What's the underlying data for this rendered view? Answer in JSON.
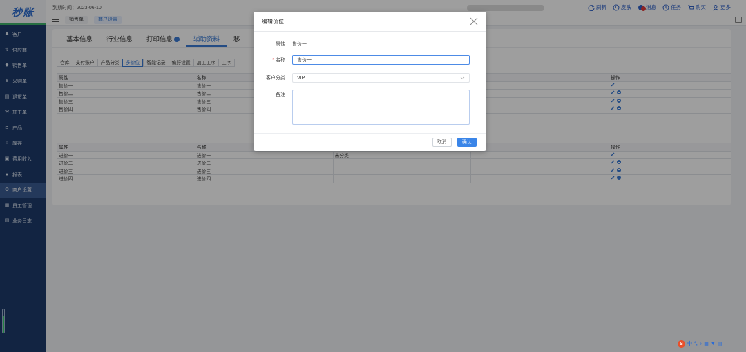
{
  "app": {
    "logo": "秒账"
  },
  "sidebar": {
    "items": [
      {
        "label": "客户",
        "icon": "users-icon"
      },
      {
        "label": "供应商",
        "icon": "supplier-icon"
      },
      {
        "label": "销售单",
        "icon": "sales-icon"
      },
      {
        "label": "采购单",
        "icon": "cart-icon"
      },
      {
        "label": "退货单",
        "icon": "return-icon"
      },
      {
        "label": "加工单",
        "icon": "process-icon"
      },
      {
        "label": "产品",
        "icon": "product-icon"
      },
      {
        "label": "库存",
        "icon": "warehouse-icon"
      },
      {
        "label": "费用收入",
        "icon": "finance-icon"
      },
      {
        "label": "报表",
        "icon": "report-icon"
      },
      {
        "label": "商户设置",
        "icon": "settings-icon",
        "active": true
      },
      {
        "label": "员工管理",
        "icon": "staff-icon"
      },
      {
        "label": "业务日志",
        "icon": "log-icon"
      }
    ],
    "battery_level": 0.7
  },
  "topbar": {
    "expire": "到期时间：2023-06-10",
    "page_tabs": [
      "销售单",
      "商户设置"
    ],
    "tools": [
      {
        "label": "刷新",
        "icon": "refresh-icon"
      },
      {
        "label": "皮肤",
        "icon": "skin-icon"
      },
      {
        "label": "消息",
        "icon": "message-icon"
      },
      {
        "label": "任务",
        "icon": "task-icon"
      },
      {
        "label": "购买",
        "icon": "cart-icon"
      },
      {
        "label": "更多",
        "icon": "user-icon"
      }
    ]
  },
  "main": {
    "tabs": [
      "基本信息",
      "行业信息",
      "打印信息",
      "辅助资料",
      "移"
    ],
    "active_tab": "辅助资料",
    "subtabs": [
      "仓库",
      "支付账户",
      "产品分类",
      "多价位",
      "智能记录",
      "偏好设置",
      "加工工序",
      "工序"
    ],
    "active_subtab": "多价位",
    "sale_table": {
      "headers": [
        "属性",
        "名称",
        "",
        "",
        "操作"
      ],
      "rows": [
        [
          "售价一",
          "售价一",
          "",
          ""
        ],
        [
          "售价二",
          "售价二",
          "",
          ""
        ],
        [
          "售价三",
          "售价三",
          "",
          ""
        ],
        [
          "售价四",
          "售价四",
          "",
          ""
        ]
      ]
    },
    "purchase_table": {
      "headers": [
        "属性",
        "名称",
        "",
        "",
        "操作"
      ],
      "rows": [
        [
          "进价一",
          "进价一",
          "未分类",
          ""
        ],
        [
          "进价二",
          "进价二",
          "",
          ""
        ],
        [
          "进价三",
          "进价三",
          "",
          ""
        ],
        [
          "进价四",
          "进价四",
          "",
          ""
        ]
      ]
    }
  },
  "dialog": {
    "title": "编辑价位",
    "attr_label": "属性",
    "attr_value": "售价一",
    "name_label": "名称",
    "name_value": "售价一",
    "category_label": "客户分类",
    "category_value": "VIP",
    "note_label": "备注",
    "note_value": "",
    "cancel": "取消",
    "confirm": "确认"
  },
  "ime": {
    "label": "中"
  }
}
